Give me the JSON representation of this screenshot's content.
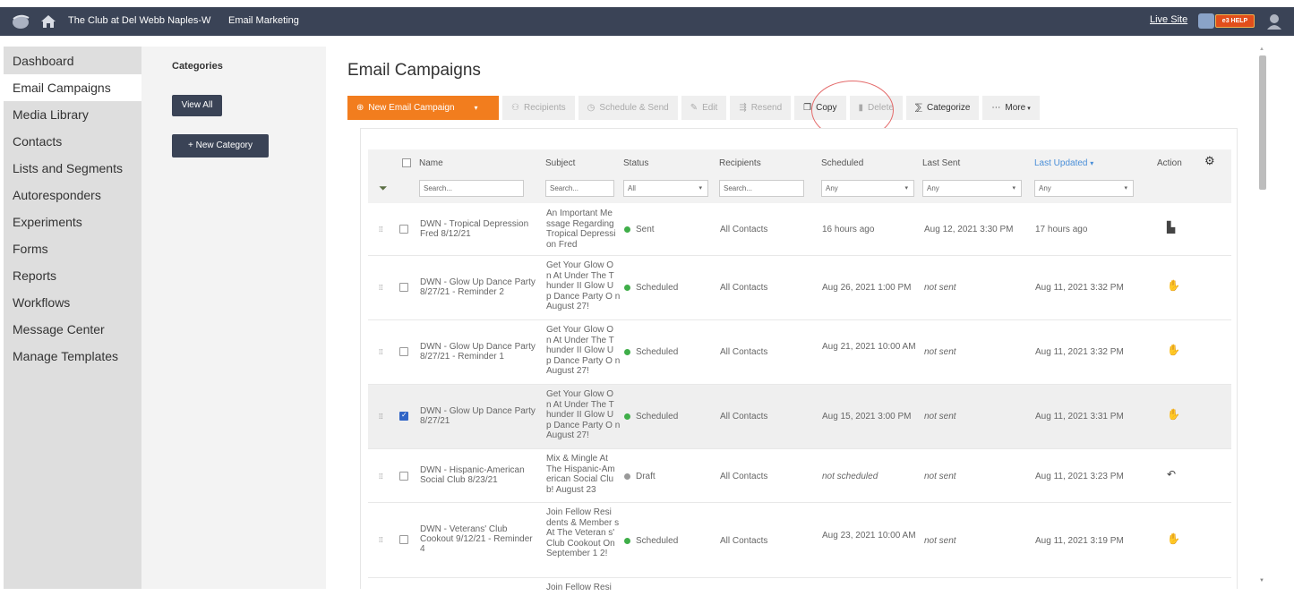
{
  "topbar": {
    "club_name": "The Club at Del Webb Naples-W",
    "module": "Email Marketing",
    "live_site": "Live Site",
    "help_label": "e3 HELP"
  },
  "sidebar": {
    "items": [
      {
        "label": "Dashboard"
      },
      {
        "label": "Email Campaigns"
      },
      {
        "label": "Media Library"
      },
      {
        "label": "Contacts"
      },
      {
        "label": "Lists and Segments"
      },
      {
        "label": "Autoresponders"
      },
      {
        "label": "Experiments"
      },
      {
        "label": "Forms"
      },
      {
        "label": "Reports"
      },
      {
        "label": "Workflows"
      },
      {
        "label": "Message Center"
      },
      {
        "label": "Manage Templates"
      }
    ]
  },
  "categories": {
    "title": "Categories",
    "view_all": "View All",
    "new_category": "+ New Category"
  },
  "page": {
    "title": "Email Campaigns"
  },
  "toolbar": {
    "new_campaign": "New Email Campaign",
    "recipients": "Recipients",
    "schedule_send": "Schedule & Send",
    "edit": "Edit",
    "resend": "Resend",
    "copy": "Copy",
    "delete": "Delete",
    "categorize": "Categorize",
    "more": "More"
  },
  "table": {
    "headers": {
      "name": "Name",
      "subject": "Subject",
      "status": "Status",
      "recipients": "Recipients",
      "scheduled": "Scheduled",
      "last_sent": "Last Sent",
      "last_updated": "Last Updated",
      "action": "Action"
    },
    "filters": {
      "name": "Search...",
      "subject": "Search...",
      "status": "All",
      "recipients": "Search...",
      "scheduled": "Any",
      "last_sent": "Any",
      "last_updated": "Any"
    },
    "rows": [
      {
        "name": "DWN - Tropical Depression Fred 8/12/21",
        "subject": "An Important Me ssage Regarding Tropical Depressi on Fred",
        "status": "Sent",
        "status_color": "#3fae49",
        "recipients": "All Contacts",
        "scheduled": "16 hours ago",
        "last_sent": "Aug 12, 2021 3:30 PM",
        "last_updated": "17 hours ago",
        "action_icon": "bar-chart-icon",
        "checked": false
      },
      {
        "name": "DWN - Glow Up Dance Party 8/27/21 - Reminder 2",
        "subject": "Get Your Glow O n At Under The T hunder II Glow U p Dance Party O n August 27!",
        "status": "Scheduled",
        "status_color": "#3fae49",
        "recipients": "All Contacts",
        "scheduled": "Aug 26, 2021 1:00 PM",
        "last_sent": "not sent",
        "last_updated": "Aug 11, 2021 3:32 PM",
        "action_icon": "stop-hand-icon",
        "checked": false
      },
      {
        "name": "DWN - Glow Up Dance Party 8/27/21 - Reminder 1",
        "subject": "Get Your Glow O n At Under The T hunder II Glow U p Dance Party O n August 27!",
        "status": "Scheduled",
        "status_color": "#3fae49",
        "recipients": "All Contacts",
        "scheduled": "Aug 21, 2021 10:00 AM",
        "last_sent": "not sent",
        "last_updated": "Aug 11, 2021 3:32 PM",
        "action_icon": "stop-hand-icon",
        "checked": false
      },
      {
        "name": "DWN - Glow Up Dance Party 8/27/21",
        "subject": "Get Your Glow O n At Under The T hunder II Glow U p Dance Party O n August 27!",
        "status": "Scheduled",
        "status_color": "#3fae49",
        "recipients": "All Contacts",
        "scheduled": "Aug 15, 2021 3:00 PM",
        "last_sent": "not sent",
        "last_updated": "Aug 11, 2021 3:31 PM",
        "action_icon": "stop-hand-icon",
        "checked": true
      },
      {
        "name": "DWN - Hispanic-American Social Club 8/23/21",
        "subject": "Mix & Mingle At The Hispanic-Am erican Social Clu b! August 23",
        "status": "Draft",
        "status_color": "#999999",
        "recipients": "All Contacts",
        "scheduled": "not scheduled",
        "last_sent": "not sent",
        "last_updated": "Aug 11, 2021 3:23 PM",
        "action_icon": "revert-icon",
        "checked": false
      },
      {
        "name": "DWN - Veterans' Club Cookout 9/12/21 - Reminder 4",
        "subject": "Join Fellow Resi dents & Member s At The Veteran s' Club Cookout On September 1 2!",
        "status": "Scheduled",
        "status_color": "#3fae49",
        "recipients": "All Contacts",
        "scheduled": "Aug 23, 2021 10:00 AM",
        "last_sent": "not sent",
        "last_updated": "Aug 11, 2021 3:19 PM",
        "action_icon": "stop-hand-icon",
        "checked": false
      },
      {
        "name": "",
        "subject": "Join Fellow Resi",
        "status": "",
        "status_color": "#3fae49",
        "recipients": "",
        "scheduled": "",
        "last_sent": "",
        "last_updated": "",
        "action_icon": "",
        "checked": false
      }
    ]
  }
}
